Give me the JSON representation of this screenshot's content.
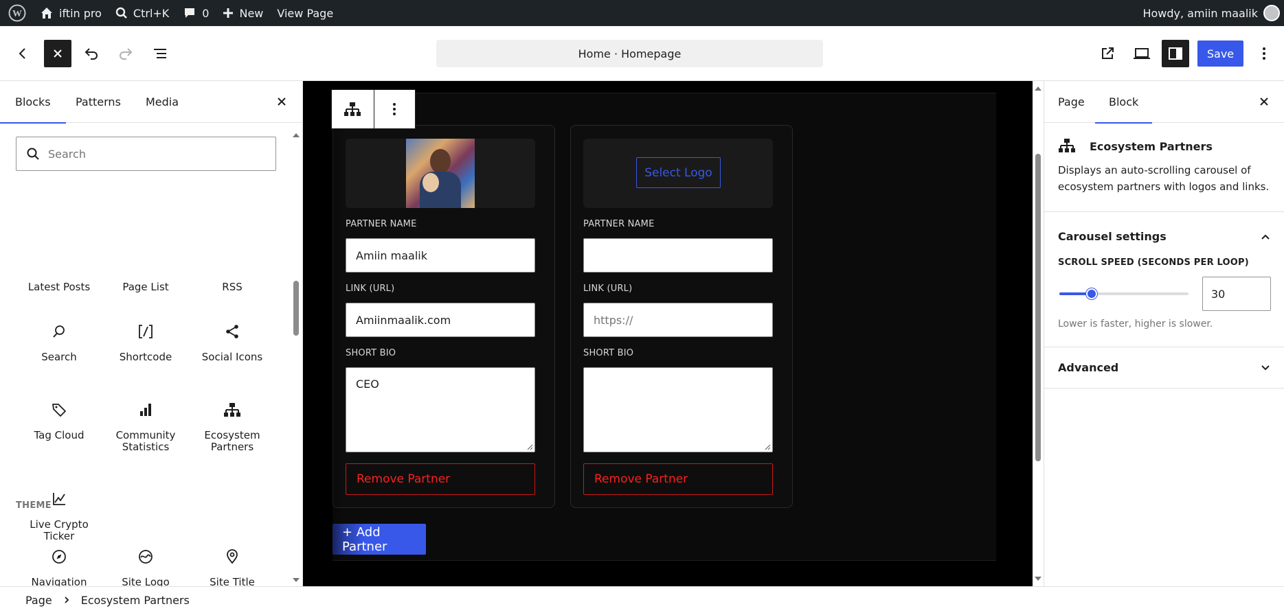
{
  "adminbar": {
    "site_name": "iftin pro",
    "shortcut": "Ctrl+K",
    "comments_count": "0",
    "new_label": "New",
    "view_page": "View Page",
    "howdy": "Howdy, amiin maalik"
  },
  "header": {
    "document_title": "Home · Homepage",
    "save_label": "Save"
  },
  "inserter": {
    "tabs": [
      "Blocks",
      "Patterns",
      "Media"
    ],
    "search_placeholder": "Search",
    "blocks": [
      {
        "label": "Latest Posts",
        "icon": "none"
      },
      {
        "label": "Page List",
        "icon": "none"
      },
      {
        "label": "RSS",
        "icon": "none"
      },
      {
        "label": "Search",
        "icon": "search-icon"
      },
      {
        "label": "Shortcode",
        "icon": "shortcode-icon"
      },
      {
        "label": "Social Icons",
        "icon": "share-icon"
      },
      {
        "label": "Tag Cloud",
        "icon": "tag-icon"
      },
      {
        "label": "Community Statistics",
        "icon": "bar-chart-icon"
      },
      {
        "label": "Ecosystem Partners",
        "icon": "hierarchy-icon"
      },
      {
        "label": "Live Crypto Ticker",
        "icon": "trend-chart-icon"
      }
    ],
    "theme_section": "THEME",
    "theme_blocks": [
      {
        "label": "Navigation",
        "icon": "compass-icon"
      },
      {
        "label": "Site Logo",
        "icon": "site-logo-icon"
      },
      {
        "label": "Site Title",
        "icon": "map-pin-icon"
      }
    ]
  },
  "canvas": {
    "partners": [
      {
        "has_logo": true,
        "name_label": "PARTNER NAME",
        "name_value": "Amiin maalik",
        "link_label": "LINK (URL)",
        "link_value": "Amiinmaalik.com",
        "link_placeholder": "https://",
        "bio_label": "SHORT BIO",
        "bio_value": "CEO",
        "remove_label": "Remove Partner"
      },
      {
        "has_logo": false,
        "select_logo_label": "Select Logo",
        "name_label": "PARTNER NAME",
        "name_value": "",
        "link_label": "LINK (URL)",
        "link_value": "",
        "link_placeholder": "https://",
        "bio_label": "SHORT BIO",
        "bio_value": "",
        "remove_label": "Remove Partner"
      }
    ],
    "add_partner_label": "+ Add Partner"
  },
  "settings": {
    "tabs": [
      "Page",
      "Block"
    ],
    "block_title": "Ecosystem Partners",
    "block_description": "Displays an auto-scrolling carousel of ecosystem partners with logos and links.",
    "carousel_section": "Carousel settings",
    "scroll_speed_label": "SCROLL SPEED (SECONDS PER LOOP)",
    "scroll_speed_value": "30",
    "scroll_speed_fraction": 0.25,
    "help_text": "Lower is faster, higher is slower.",
    "advanced_section": "Advanced"
  },
  "breadcrumb": {
    "items": [
      "Page",
      "Ecosystem Partners"
    ]
  },
  "colors": {
    "accent": "#3858e9",
    "danger": "#cc1818",
    "adminbar": "#1d2327"
  }
}
